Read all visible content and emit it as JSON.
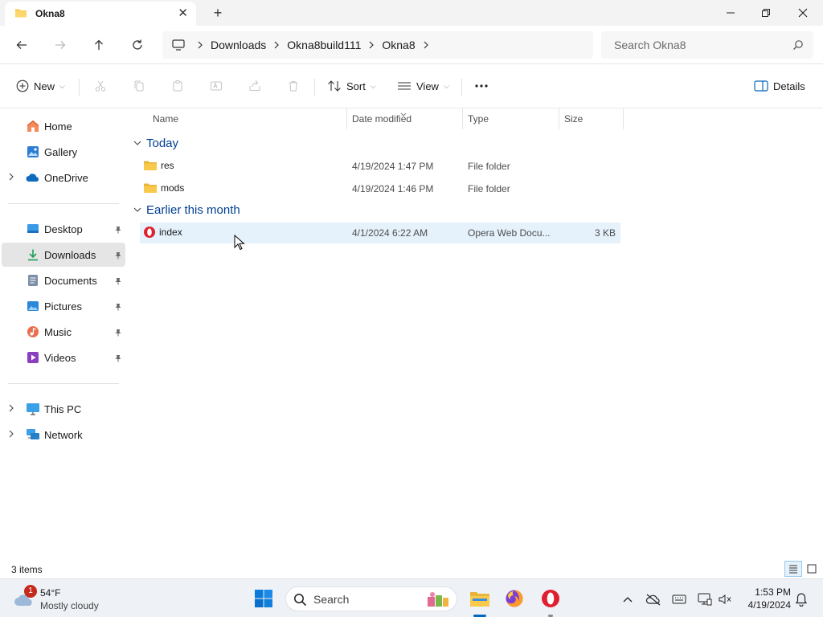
{
  "window": {
    "tab_title": "Okna8",
    "new_tab_label": "+",
    "close_tab_label": "✕"
  },
  "address": {
    "breadcrumbs": [
      "Downloads",
      "Okna8build111",
      "Okna8"
    ],
    "search_placeholder": "Search Okna8"
  },
  "commands": {
    "new_label": "New",
    "sort_label": "Sort",
    "view_label": "View",
    "details_label": "Details"
  },
  "sidebar": {
    "quick": [
      {
        "label": "Home",
        "icon": "home-icon"
      },
      {
        "label": "Gallery",
        "icon": "gallery-icon"
      },
      {
        "label": "OneDrive",
        "icon": "onedrive-icon"
      }
    ],
    "pinned": [
      {
        "label": "Desktop",
        "icon": "desktop-icon"
      },
      {
        "label": "Downloads",
        "icon": "downloads-icon",
        "selected": true
      },
      {
        "label": "Documents",
        "icon": "documents-icon"
      },
      {
        "label": "Pictures",
        "icon": "pictures-icon"
      },
      {
        "label": "Music",
        "icon": "music-icon"
      },
      {
        "label": "Videos",
        "icon": "videos-icon"
      }
    ],
    "devices": [
      {
        "label": "This PC",
        "icon": "this-pc-icon"
      },
      {
        "label": "Network",
        "icon": "network-icon"
      }
    ]
  },
  "columns": {
    "name": "Name",
    "date": "Date modified",
    "type": "Type",
    "size": "Size"
  },
  "groups": [
    {
      "title": "Today",
      "files": [
        {
          "name": "res",
          "date": "4/19/2024 1:47 PM",
          "type": "File folder",
          "size": "",
          "icon": "folder-icon"
        },
        {
          "name": "mods",
          "date": "4/19/2024 1:46 PM",
          "type": "File folder",
          "size": "",
          "icon": "folder-icon"
        }
      ]
    },
    {
      "title": "Earlier this month",
      "files": [
        {
          "name": "index",
          "date": "4/1/2024 6:22 AM",
          "type": "Opera Web Docu...",
          "size": "3 KB",
          "icon": "opera-icon",
          "hovered": true
        }
      ]
    }
  ],
  "status": {
    "item_count": "3 items"
  },
  "taskbar": {
    "weather_temp": "54°F",
    "weather_condition": "Mostly cloudy",
    "weather_badge": "1",
    "search_label": "Search",
    "time": "1:53 PM",
    "date": "4/19/2024"
  },
  "colors": {
    "accent": "#0067c0",
    "group_header": "#003e92",
    "selection": "#e5f1fb",
    "folder": "#f8c94a"
  }
}
